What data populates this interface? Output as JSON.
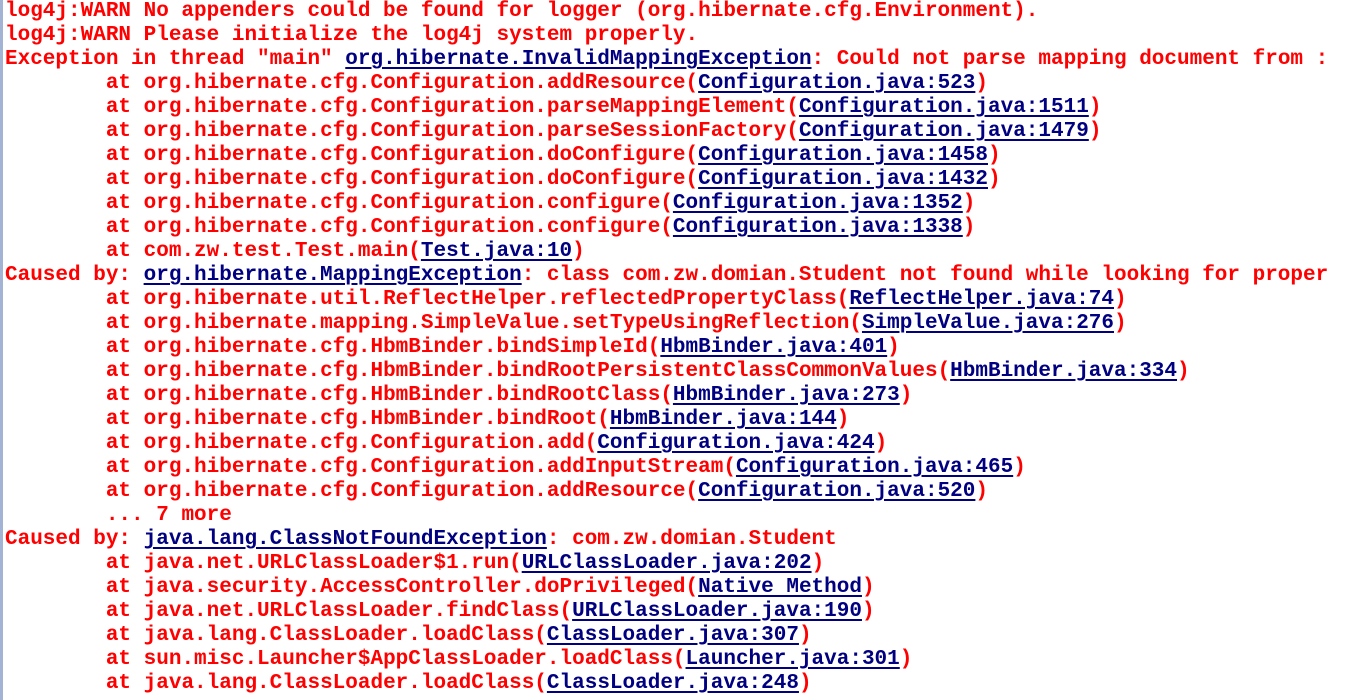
{
  "colors": {
    "error_text": "#ff0000",
    "link_text": "#000080",
    "background": "#ffffff"
  },
  "console": {
    "lines": [
      {
        "pre": "log4j:WARN No appenders could be found for logger (org.hibernate.cfg.Environment).",
        "link": "",
        "post": ""
      },
      {
        "pre": "log4j:WARN Please initialize the log4j system properly.",
        "link": "",
        "post": ""
      },
      {
        "pre": "Exception in thread \"main\" ",
        "link": "org.hibernate.InvalidMappingException",
        "post": ": Could not parse mapping document from :"
      },
      {
        "pre": "\tat org.hibernate.cfg.Configuration.addResource(",
        "link": "Configuration.java:523",
        "post": ")"
      },
      {
        "pre": "\tat org.hibernate.cfg.Configuration.parseMappingElement(",
        "link": "Configuration.java:1511",
        "post": ")"
      },
      {
        "pre": "\tat org.hibernate.cfg.Configuration.parseSessionFactory(",
        "link": "Configuration.java:1479",
        "post": ")"
      },
      {
        "pre": "\tat org.hibernate.cfg.Configuration.doConfigure(",
        "link": "Configuration.java:1458",
        "post": ")"
      },
      {
        "pre": "\tat org.hibernate.cfg.Configuration.doConfigure(",
        "link": "Configuration.java:1432",
        "post": ")"
      },
      {
        "pre": "\tat org.hibernate.cfg.Configuration.configure(",
        "link": "Configuration.java:1352",
        "post": ")"
      },
      {
        "pre": "\tat org.hibernate.cfg.Configuration.configure(",
        "link": "Configuration.java:1338",
        "post": ")"
      },
      {
        "pre": "\tat com.zw.test.Test.main(",
        "link": "Test.java:10",
        "post": ")"
      },
      {
        "pre": "Caused by: ",
        "link": "org.hibernate.MappingException",
        "post": ": class com.zw.domian.Student not found while looking for proper"
      },
      {
        "pre": "\tat org.hibernate.util.ReflectHelper.reflectedPropertyClass(",
        "link": "ReflectHelper.java:74",
        "post": ")"
      },
      {
        "pre": "\tat org.hibernate.mapping.SimpleValue.setTypeUsingReflection(",
        "link": "SimpleValue.java:276",
        "post": ")"
      },
      {
        "pre": "\tat org.hibernate.cfg.HbmBinder.bindSimpleId(",
        "link": "HbmBinder.java:401",
        "post": ")"
      },
      {
        "pre": "\tat org.hibernate.cfg.HbmBinder.bindRootPersistentClassCommonValues(",
        "link": "HbmBinder.java:334",
        "post": ")"
      },
      {
        "pre": "\tat org.hibernate.cfg.HbmBinder.bindRootClass(",
        "link": "HbmBinder.java:273",
        "post": ")"
      },
      {
        "pre": "\tat org.hibernate.cfg.HbmBinder.bindRoot(",
        "link": "HbmBinder.java:144",
        "post": ")"
      },
      {
        "pre": "\tat org.hibernate.cfg.Configuration.add(",
        "link": "Configuration.java:424",
        "post": ")"
      },
      {
        "pre": "\tat org.hibernate.cfg.Configuration.addInputStream(",
        "link": "Configuration.java:465",
        "post": ")"
      },
      {
        "pre": "\tat org.hibernate.cfg.Configuration.addResource(",
        "link": "Configuration.java:520",
        "post": ")"
      },
      {
        "pre": "\t... 7 more",
        "link": "",
        "post": ""
      },
      {
        "pre": "Caused by: ",
        "link": "java.lang.ClassNotFoundException",
        "post": ": com.zw.domian.Student"
      },
      {
        "pre": "\tat java.net.URLClassLoader$1.run(",
        "link": "URLClassLoader.java:202",
        "post": ")"
      },
      {
        "pre": "\tat java.security.AccessController.doPrivileged(",
        "link": "Native Method",
        "post": ")"
      },
      {
        "pre": "\tat java.net.URLClassLoader.findClass(",
        "link": "URLClassLoader.java:190",
        "post": ")"
      },
      {
        "pre": "\tat java.lang.ClassLoader.loadClass(",
        "link": "ClassLoader.java:307",
        "post": ")"
      },
      {
        "pre": "\tat sun.misc.Launcher$AppClassLoader.loadClass(",
        "link": "Launcher.java:301",
        "post": ")"
      },
      {
        "pre": "\tat java.lang.ClassLoader.loadClass(",
        "link": "ClassLoader.java:248",
        "post": ")"
      }
    ]
  }
}
